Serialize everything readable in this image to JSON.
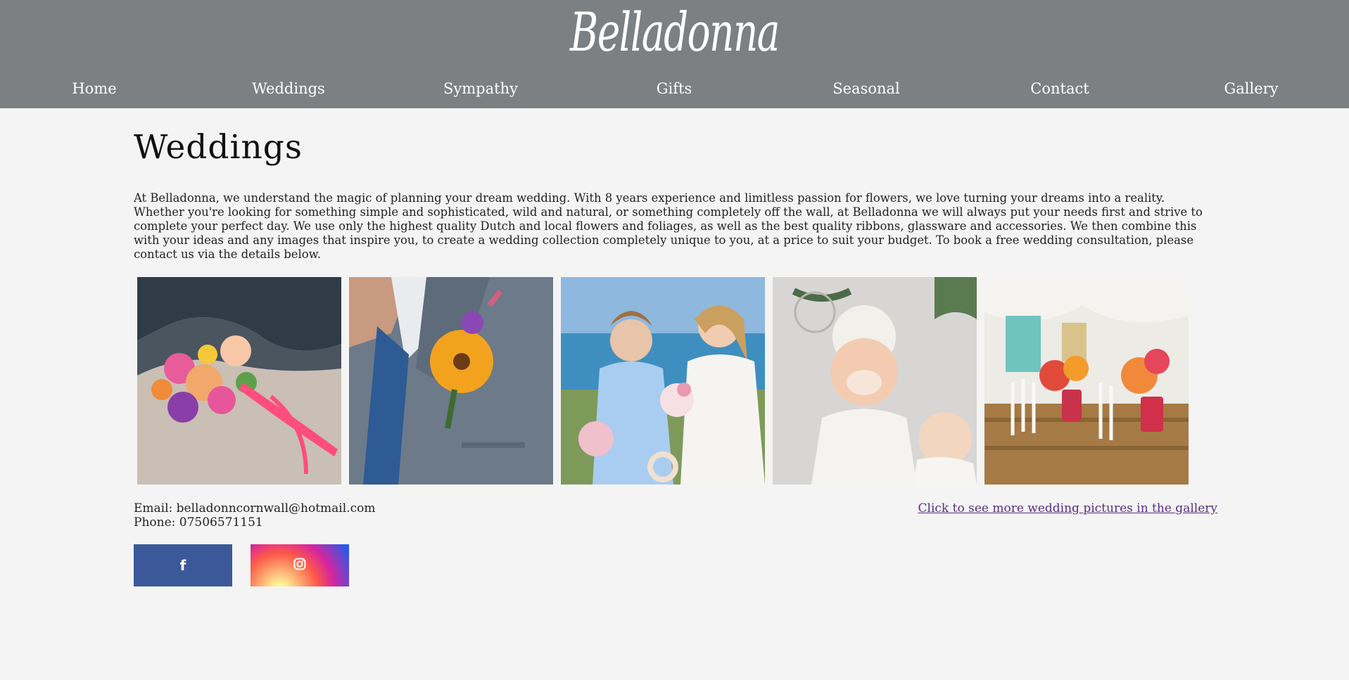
{
  "header": {
    "logo_text": "Belladonna",
    "background_color": "#7d8083"
  },
  "nav": {
    "items": [
      {
        "label": "Home"
      },
      {
        "label": "Weddings"
      },
      {
        "label": "Sympathy"
      },
      {
        "label": "Gifts"
      },
      {
        "label": "Seasonal"
      },
      {
        "label": "Contact"
      },
      {
        "label": "Gallery"
      }
    ]
  },
  "main": {
    "title": "Weddings",
    "intro": "At Belladonna, we understand the magic of planning your dream wedding. With 8 years experience and limitless passion for flowers, we love turning your dreams into a reality. Whether you're looking for something simple and sophisticated, wild and natural, or something completely off the wall, at Belladonna we will always put your needs first and strive to complete your perfect day. We use only the highest quality Dutch and local flowers and foliages, as well as the best quality ribbons, glassware and accessories. We then combine this with your ideas and any images that inspire you, to create a wedding collection completely unique to you, at a price to suit your budget. To book a free wedding consultation, please contact us via the details below.",
    "gallery": [
      {
        "subject": "bridal bouquet on beach"
      },
      {
        "subject": "groom sunflower buttonhole"
      },
      {
        "subject": "bride and bridesmaid with bouquets"
      },
      {
        "subject": "flower girl with gypsophila crown"
      },
      {
        "subject": "reception table flowers in jars"
      }
    ]
  },
  "contact": {
    "email": "Email: belladonncornwall@hotmail.com",
    "phone": "Phone: 07506571151"
  },
  "gallery_link": "Click to see more wedding pictures in the gallery",
  "social": {
    "facebook_color": "#3b5998",
    "facebook_icon": "facebook-icon",
    "instagram_icon": "instagram-icon"
  },
  "colors": {
    "page_background": "#f4f4f4",
    "link": "#5a2d82"
  }
}
